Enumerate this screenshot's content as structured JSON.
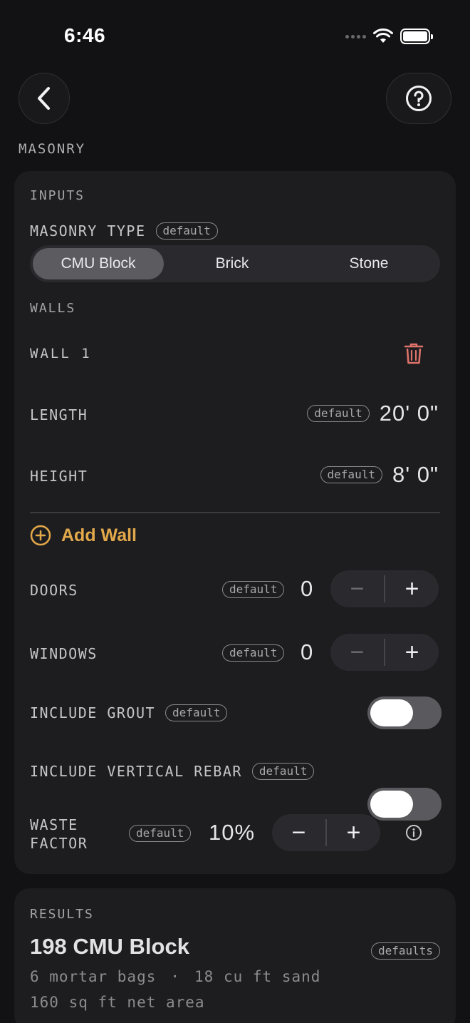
{
  "status_bar": {
    "time": "6:46"
  },
  "page": {
    "section": "MASONRY"
  },
  "inputs": {
    "header": "INPUTS",
    "masonry_type": {
      "label": "MASONRY TYPE",
      "badge": "default",
      "options": [
        "CMU Block",
        "Brick",
        "Stone"
      ],
      "selected": "CMU Block"
    },
    "walls_header": "WALLS",
    "wall": {
      "title": "WALL 1",
      "length": {
        "label": "LENGTH",
        "badge": "default",
        "value": "20' 0\""
      },
      "height": {
        "label": "HEIGHT",
        "badge": "default",
        "value": "8' 0\""
      }
    },
    "add_wall_label": "Add Wall",
    "doors": {
      "label": "DOORS",
      "badge": "default",
      "value": "0"
    },
    "windows": {
      "label": "WINDOWS",
      "badge": "default",
      "value": "0"
    },
    "include_grout": {
      "label": "INCLUDE GROUT",
      "badge": "default",
      "on": true
    },
    "include_rebar": {
      "label": "INCLUDE VERTICAL REBAR",
      "badge": "default",
      "on": true
    },
    "waste_factor": {
      "label_line1": "WASTE",
      "label_line2": "FACTOR",
      "badge": "default",
      "value": "10%"
    }
  },
  "results": {
    "header": "RESULTS",
    "headline": "198 CMU Block",
    "badge": "defaults",
    "line1_a": "6 mortar bags",
    "line1_sep": "·",
    "line1_b": "18 cu ft sand",
    "line2": "160 sq ft net area"
  },
  "colors": {
    "accent": "#e2a84a",
    "danger": "#e0736a",
    "background": "#121214",
    "card": "#1d1d20"
  }
}
